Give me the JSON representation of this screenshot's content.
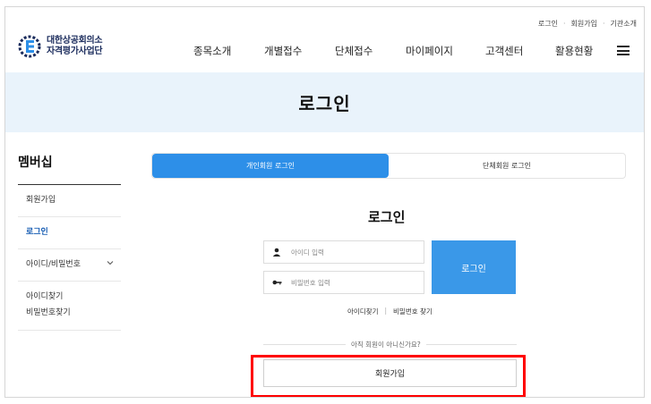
{
  "util_links": [
    "로그인",
    "회원가입",
    "기관소개"
  ],
  "logo": {
    "line1": "대한상공회의소",
    "line2": "자격평가사업단"
  },
  "gnb": [
    "종목소개",
    "개별접수",
    "단체접수",
    "마이페이지",
    "고객센터",
    "활용현황"
  ],
  "hero_title": "로그인",
  "side": {
    "title": "멤버십",
    "items": [
      "회원가입",
      "로그인",
      "아이디/비밀번호"
    ],
    "sub_items": [
      "아이디찾기",
      "비밀번호찾기"
    ]
  },
  "tabs": [
    "개인회원 로그인",
    "단체회원 로그인"
  ],
  "login": {
    "title": "로그인",
    "id_placeholder": "아이디 입력",
    "pw_placeholder": "비밀번호 입력",
    "button": "로그인",
    "find_id": "아이디찾기",
    "find_pw": "비밀번호 찾기",
    "not_member": "아직 회원이 아니신가요?",
    "join": "회원가입"
  },
  "colors": {
    "accent": "#2d8fe8",
    "hero_bg": "#e9f3fb",
    "highlight": "#ff0000",
    "logo_blue": "#1a2b5c"
  }
}
